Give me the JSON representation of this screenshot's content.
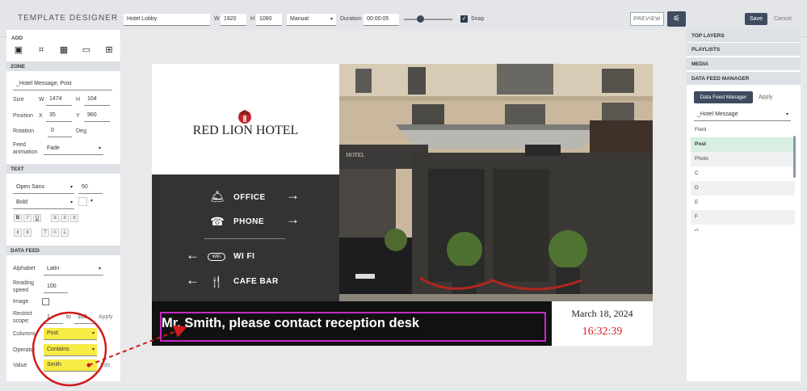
{
  "app": {
    "title": "TEMPLATE DESIGNER"
  },
  "toolbar": {
    "name_value": "Hotel Lobby",
    "w_label": "W",
    "w_value": "1920",
    "h_label": "H",
    "h_value": "1080",
    "mode_value": "Manual",
    "duration_label": "Duration",
    "duration_value": "00:00:05",
    "snap_label": "Snap",
    "preview_label": "PREVIEW",
    "save_label": "Save",
    "cancel_label": "Cancel"
  },
  "left": {
    "add_label": "ADD",
    "zone": {
      "header": "ZONE",
      "name_value": "_Hotel Message, Post",
      "size_label": "Size",
      "w_label": "W",
      "w_value": "1474",
      "h_label": "H",
      "h_value": "104",
      "position_label": "Position",
      "x_label": "X",
      "x_value": "35",
      "y_label": "Y",
      "y_value": "960",
      "rotation_label": "Rotation",
      "rotation_value": "0",
      "rotation_unit": "Deg.",
      "feed_label_1": "Feed",
      "feed_label_2": "animation",
      "feed_value": "Fade"
    },
    "text": {
      "header": "TEXT",
      "font_value": "Open Sans",
      "size_value": "50",
      "weight_value": "Bold",
      "b": "B",
      "i": "I",
      "u": "U"
    },
    "datafeed": {
      "header": "DATA FEED",
      "alphabet_label": "Alphabet",
      "alphabet_value": "Latin",
      "reading_label_1": "Reading",
      "reading_label_2": "speed",
      "reading_value": "100",
      "image_label": "Image",
      "restrict_label_1": "Restrict",
      "restrict_label_2": "scope:",
      "restrict_from": "1",
      "restrict_to_label": "to",
      "restrict_to": "100",
      "apply_label": "Apply",
      "columns_label": "Columns",
      "columns_value": "Post",
      "operator_label": "Operator",
      "operator_value": "Contains",
      "value_label": "Value",
      "value_value": "Smith",
      "edit_label": "Edit"
    }
  },
  "canvas": {
    "logo_text": "RED LION HOTEL",
    "menu": [
      {
        "label": "OFFICE",
        "icon": "bell-icon",
        "arrow": "→"
      },
      {
        "label": "PHONE",
        "icon": "phone-icon",
        "arrow": "→"
      },
      {
        "label": "WI FI",
        "icon": "wifi-icon",
        "arrow": "←"
      },
      {
        "label": "CAFE BAR",
        "icon": "cutlery-icon",
        "arrow": "←"
      }
    ],
    "sign_text": "HOTEL",
    "message": "Mr. Smith, please contact reception desk",
    "date": "March 18, 2024",
    "time": "16:32:39"
  },
  "right": {
    "sections": [
      "TOP LAYERS",
      "PLAYLISTS",
      "MEDIA",
      "DATA FEED MANAGER"
    ],
    "dfm_button": "Data Feed Manager",
    "apply_label": "Apply",
    "feed_select": "_Hotel Message",
    "fields": [
      "Field",
      "Post",
      "Photo",
      "C",
      "D",
      "E",
      "F",
      "G"
    ]
  },
  "colors": {
    "accent": "#3f4c5f",
    "highlight": "#f7ec46",
    "annotation": "#d11a1a",
    "selected_row": "#d8efe2",
    "clock": "#d81d1d"
  }
}
